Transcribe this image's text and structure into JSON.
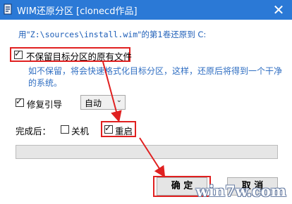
{
  "window": {
    "title": "WIM还原分区 [clonecd作品]",
    "close_label": "✕"
  },
  "info": {
    "prefix": "用\"",
    "path": "Z:\\sources\\install.wim",
    "suffix": "\"的第1卷还原到 C:"
  },
  "options": {
    "keep_files": {
      "label": "不保留目标分区的原有文件",
      "checked": true
    },
    "hint": "如不保留，将会快速格式化目标分区，这样，还原后将得到一个干净的系统。",
    "repair_boot": {
      "label": "修复引导",
      "checked": true
    },
    "repair_mode": {
      "selected": "自动"
    }
  },
  "after": {
    "label": "完成后：",
    "shutdown": {
      "label": "关机",
      "checked": false
    },
    "restart": {
      "label": "重启",
      "checked": true
    }
  },
  "progress": {
    "value": 0
  },
  "buttons": {
    "ok": "确 定",
    "cancel": "取 消"
  },
  "watermark": "win7w.com",
  "colors": {
    "titlebar": "#2b79d6",
    "annotation_red": "#e02020",
    "link_blue": "#2f6ec2"
  }
}
